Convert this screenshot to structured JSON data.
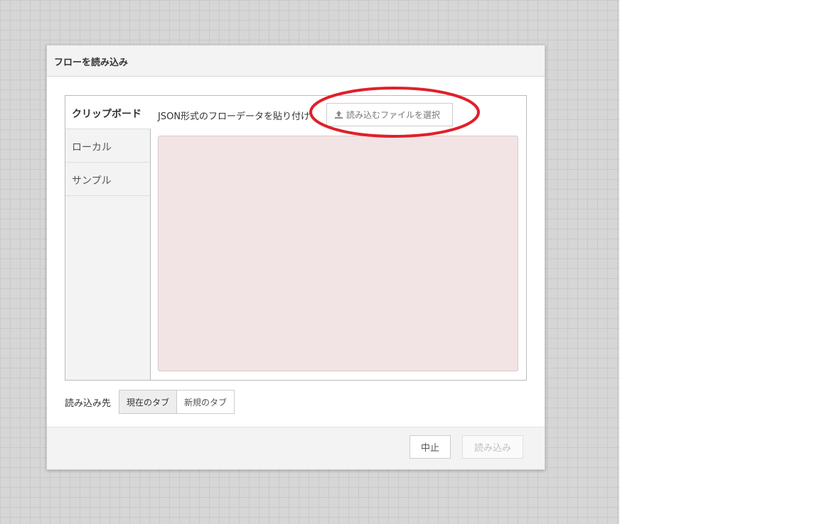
{
  "dialog": {
    "title": "フローを読み込み"
  },
  "tabs": [
    {
      "label": "クリップボード",
      "active": true
    },
    {
      "label": "ローカル",
      "active": false
    },
    {
      "label": "サンプル",
      "active": false
    }
  ],
  "clipboard": {
    "paste_label": "JSON形式のフローデータを貼り付け",
    "file_button_label": "読み込むファイルを選択",
    "file_button_icon": "upload-icon",
    "textarea_value": ""
  },
  "import_target": {
    "label": "読み込み先",
    "options": [
      "現在のタブ",
      "新規のタブ"
    ],
    "selected": "現在のタブ"
  },
  "footer": {
    "cancel_label": "中止",
    "import_label": "読み込み"
  },
  "annotation": {
    "color": "#e0202a",
    "shape": "ellipse"
  }
}
